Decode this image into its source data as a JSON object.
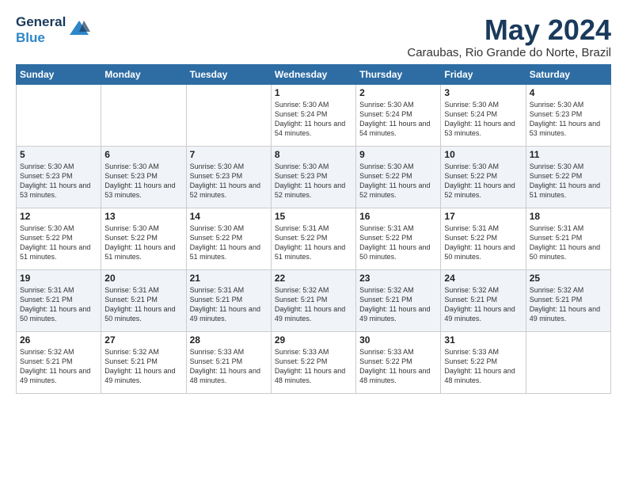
{
  "logo": {
    "general": "General",
    "blue": "Blue"
  },
  "title": "May 2024",
  "subtitle": "Caraubas, Rio Grande do Norte, Brazil",
  "header_color": "#2e6da4",
  "weekdays": [
    "Sunday",
    "Monday",
    "Tuesday",
    "Wednesday",
    "Thursday",
    "Friday",
    "Saturday"
  ],
  "weeks": [
    [
      {
        "day": "",
        "sunrise": "",
        "sunset": "",
        "daylight": ""
      },
      {
        "day": "",
        "sunrise": "",
        "sunset": "",
        "daylight": ""
      },
      {
        "day": "",
        "sunrise": "",
        "sunset": "",
        "daylight": ""
      },
      {
        "day": "1",
        "sunrise": "Sunrise: 5:30 AM",
        "sunset": "Sunset: 5:24 PM",
        "daylight": "Daylight: 11 hours and 54 minutes."
      },
      {
        "day": "2",
        "sunrise": "Sunrise: 5:30 AM",
        "sunset": "Sunset: 5:24 PM",
        "daylight": "Daylight: 11 hours and 54 minutes."
      },
      {
        "day": "3",
        "sunrise": "Sunrise: 5:30 AM",
        "sunset": "Sunset: 5:24 PM",
        "daylight": "Daylight: 11 hours and 53 minutes."
      },
      {
        "day": "4",
        "sunrise": "Sunrise: 5:30 AM",
        "sunset": "Sunset: 5:23 PM",
        "daylight": "Daylight: 11 hours and 53 minutes."
      }
    ],
    [
      {
        "day": "5",
        "sunrise": "Sunrise: 5:30 AM",
        "sunset": "Sunset: 5:23 PM",
        "daylight": "Daylight: 11 hours and 53 minutes."
      },
      {
        "day": "6",
        "sunrise": "Sunrise: 5:30 AM",
        "sunset": "Sunset: 5:23 PM",
        "daylight": "Daylight: 11 hours and 53 minutes."
      },
      {
        "day": "7",
        "sunrise": "Sunrise: 5:30 AM",
        "sunset": "Sunset: 5:23 PM",
        "daylight": "Daylight: 11 hours and 52 minutes."
      },
      {
        "day": "8",
        "sunrise": "Sunrise: 5:30 AM",
        "sunset": "Sunset: 5:23 PM",
        "daylight": "Daylight: 11 hours and 52 minutes."
      },
      {
        "day": "9",
        "sunrise": "Sunrise: 5:30 AM",
        "sunset": "Sunset: 5:22 PM",
        "daylight": "Daylight: 11 hours and 52 minutes."
      },
      {
        "day": "10",
        "sunrise": "Sunrise: 5:30 AM",
        "sunset": "Sunset: 5:22 PM",
        "daylight": "Daylight: 11 hours and 52 minutes."
      },
      {
        "day": "11",
        "sunrise": "Sunrise: 5:30 AM",
        "sunset": "Sunset: 5:22 PM",
        "daylight": "Daylight: 11 hours and 51 minutes."
      }
    ],
    [
      {
        "day": "12",
        "sunrise": "Sunrise: 5:30 AM",
        "sunset": "Sunset: 5:22 PM",
        "daylight": "Daylight: 11 hours and 51 minutes."
      },
      {
        "day": "13",
        "sunrise": "Sunrise: 5:30 AM",
        "sunset": "Sunset: 5:22 PM",
        "daylight": "Daylight: 11 hours and 51 minutes."
      },
      {
        "day": "14",
        "sunrise": "Sunrise: 5:30 AM",
        "sunset": "Sunset: 5:22 PM",
        "daylight": "Daylight: 11 hours and 51 minutes."
      },
      {
        "day": "15",
        "sunrise": "Sunrise: 5:31 AM",
        "sunset": "Sunset: 5:22 PM",
        "daylight": "Daylight: 11 hours and 51 minutes."
      },
      {
        "day": "16",
        "sunrise": "Sunrise: 5:31 AM",
        "sunset": "Sunset: 5:22 PM",
        "daylight": "Daylight: 11 hours and 50 minutes."
      },
      {
        "day": "17",
        "sunrise": "Sunrise: 5:31 AM",
        "sunset": "Sunset: 5:22 PM",
        "daylight": "Daylight: 11 hours and 50 minutes."
      },
      {
        "day": "18",
        "sunrise": "Sunrise: 5:31 AM",
        "sunset": "Sunset: 5:21 PM",
        "daylight": "Daylight: 11 hours and 50 minutes."
      }
    ],
    [
      {
        "day": "19",
        "sunrise": "Sunrise: 5:31 AM",
        "sunset": "Sunset: 5:21 PM",
        "daylight": "Daylight: 11 hours and 50 minutes."
      },
      {
        "day": "20",
        "sunrise": "Sunrise: 5:31 AM",
        "sunset": "Sunset: 5:21 PM",
        "daylight": "Daylight: 11 hours and 50 minutes."
      },
      {
        "day": "21",
        "sunrise": "Sunrise: 5:31 AM",
        "sunset": "Sunset: 5:21 PM",
        "daylight": "Daylight: 11 hours and 49 minutes."
      },
      {
        "day": "22",
        "sunrise": "Sunrise: 5:32 AM",
        "sunset": "Sunset: 5:21 PM",
        "daylight": "Daylight: 11 hours and 49 minutes."
      },
      {
        "day": "23",
        "sunrise": "Sunrise: 5:32 AM",
        "sunset": "Sunset: 5:21 PM",
        "daylight": "Daylight: 11 hours and 49 minutes."
      },
      {
        "day": "24",
        "sunrise": "Sunrise: 5:32 AM",
        "sunset": "Sunset: 5:21 PM",
        "daylight": "Daylight: 11 hours and 49 minutes."
      },
      {
        "day": "25",
        "sunrise": "Sunrise: 5:32 AM",
        "sunset": "Sunset: 5:21 PM",
        "daylight": "Daylight: 11 hours and 49 minutes."
      }
    ],
    [
      {
        "day": "26",
        "sunrise": "Sunrise: 5:32 AM",
        "sunset": "Sunset: 5:21 PM",
        "daylight": "Daylight: 11 hours and 49 minutes."
      },
      {
        "day": "27",
        "sunrise": "Sunrise: 5:32 AM",
        "sunset": "Sunset: 5:21 PM",
        "daylight": "Daylight: 11 hours and 49 minutes."
      },
      {
        "day": "28",
        "sunrise": "Sunrise: 5:33 AM",
        "sunset": "Sunset: 5:21 PM",
        "daylight": "Daylight: 11 hours and 48 minutes."
      },
      {
        "day": "29",
        "sunrise": "Sunrise: 5:33 AM",
        "sunset": "Sunset: 5:22 PM",
        "daylight": "Daylight: 11 hours and 48 minutes."
      },
      {
        "day": "30",
        "sunrise": "Sunrise: 5:33 AM",
        "sunset": "Sunset: 5:22 PM",
        "daylight": "Daylight: 11 hours and 48 minutes."
      },
      {
        "day": "31",
        "sunrise": "Sunrise: 5:33 AM",
        "sunset": "Sunset: 5:22 PM",
        "daylight": "Daylight: 11 hours and 48 minutes."
      },
      {
        "day": "",
        "sunrise": "",
        "sunset": "",
        "daylight": ""
      }
    ]
  ]
}
